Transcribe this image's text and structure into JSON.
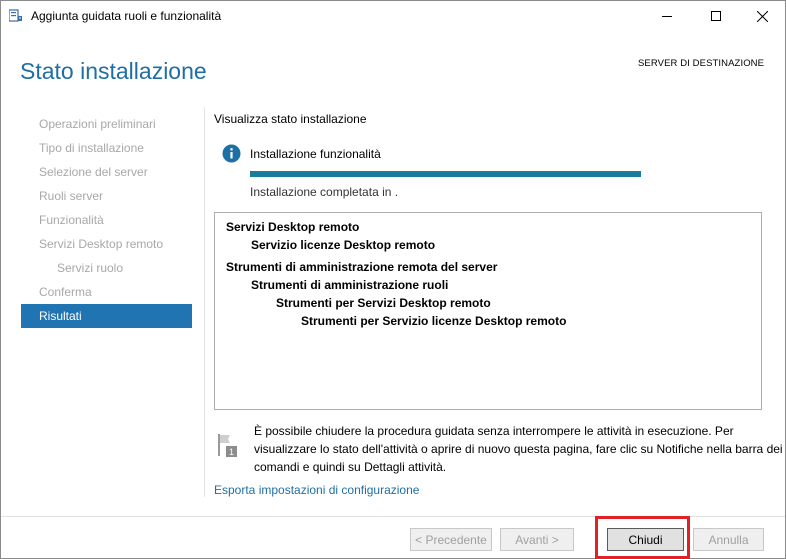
{
  "window": {
    "title": "Aggiunta guidata ruoli e funzionalità"
  },
  "header": {
    "page_title": "Stato installazione",
    "destination_server": "SERVER DI DESTINAZIONE"
  },
  "sidebar": {
    "items": [
      {
        "label": "Operazioni preliminari",
        "state": "disabled",
        "sub": false
      },
      {
        "label": "Tipo di installazione",
        "state": "disabled",
        "sub": false
      },
      {
        "label": "Selezione del server",
        "state": "disabled",
        "sub": false
      },
      {
        "label": "Ruoli server",
        "state": "disabled",
        "sub": false
      },
      {
        "label": "Funzionalità",
        "state": "disabled",
        "sub": false
      },
      {
        "label": "Servizi Desktop remoto",
        "state": "disabled",
        "sub": false
      },
      {
        "label": "Servizi ruolo",
        "state": "disabled",
        "sub": true
      },
      {
        "label": "Conferma",
        "state": "disabled",
        "sub": false
      },
      {
        "label": "Risultati",
        "state": "active",
        "sub": false
      }
    ]
  },
  "main": {
    "heading": "Visualizza stato installazione",
    "info_label": "Installazione funzionalità",
    "progress_fraction": 1.0,
    "status": "Installazione completata in .",
    "results": [
      {
        "text": "Servizi Desktop remoto",
        "level": 0
      },
      {
        "text": "Servizio licenze Desktop remoto",
        "level": 1
      },
      {
        "text": "Strumenti di amministrazione remota del server",
        "level": 0,
        "gap_before": true
      },
      {
        "text": "Strumenti di amministrazione ruoli",
        "level": 1
      },
      {
        "text": "Strumenti per Servizi Desktop remoto",
        "level": 2
      },
      {
        "text": "Strumenti per Servizio licenze Desktop remoto",
        "level": 3
      }
    ],
    "note": "È possibile chiudere la procedura guidata senza interrompere le attività in esecuzione. Per visualizzare lo stato dell'attività o aprire di nuovo questa pagina, fare clic su Notifiche nella barra dei comandi e quindi su Dettagli attività.",
    "note_icon_badge": "1",
    "export_link": "Esporta impostazioni di configurazione"
  },
  "footer": {
    "prev_label": "< Precedente",
    "next_label": "Avanti >",
    "close_label": "Chiudi",
    "cancel_label": "Annulla"
  },
  "colors": {
    "accent": "#1e6fa5",
    "active_item": "#1f74b1",
    "progress": "#177d9b",
    "highlight": "#e02226"
  }
}
